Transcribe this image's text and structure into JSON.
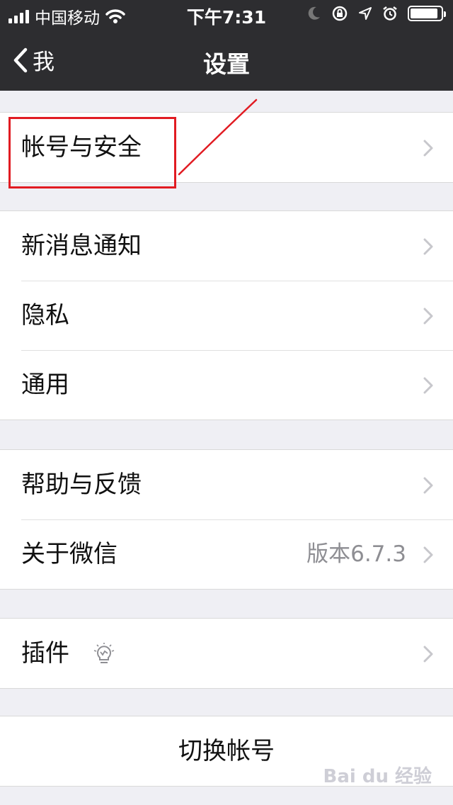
{
  "status_bar": {
    "carrier": "中国移动",
    "time": "下午7:31"
  },
  "nav": {
    "back_label": "我",
    "title": "设置"
  },
  "groups": [
    {
      "items": [
        {
          "label": "帐号与安全"
        }
      ]
    },
    {
      "items": [
        {
          "label": "新消息通知"
        },
        {
          "label": "隐私"
        },
        {
          "label": "通用"
        }
      ]
    },
    {
      "items": [
        {
          "label": "帮助与反馈"
        },
        {
          "label": "关于微信",
          "detail": "版本6.7.3"
        }
      ]
    },
    {
      "items": [
        {
          "label": "插件"
        }
      ]
    }
  ],
  "switch_account": {
    "label": "切换帐号"
  },
  "colors": {
    "nav_bg": "#2d2d30",
    "page_bg": "#efeff4",
    "annotation": "#e11b22"
  }
}
